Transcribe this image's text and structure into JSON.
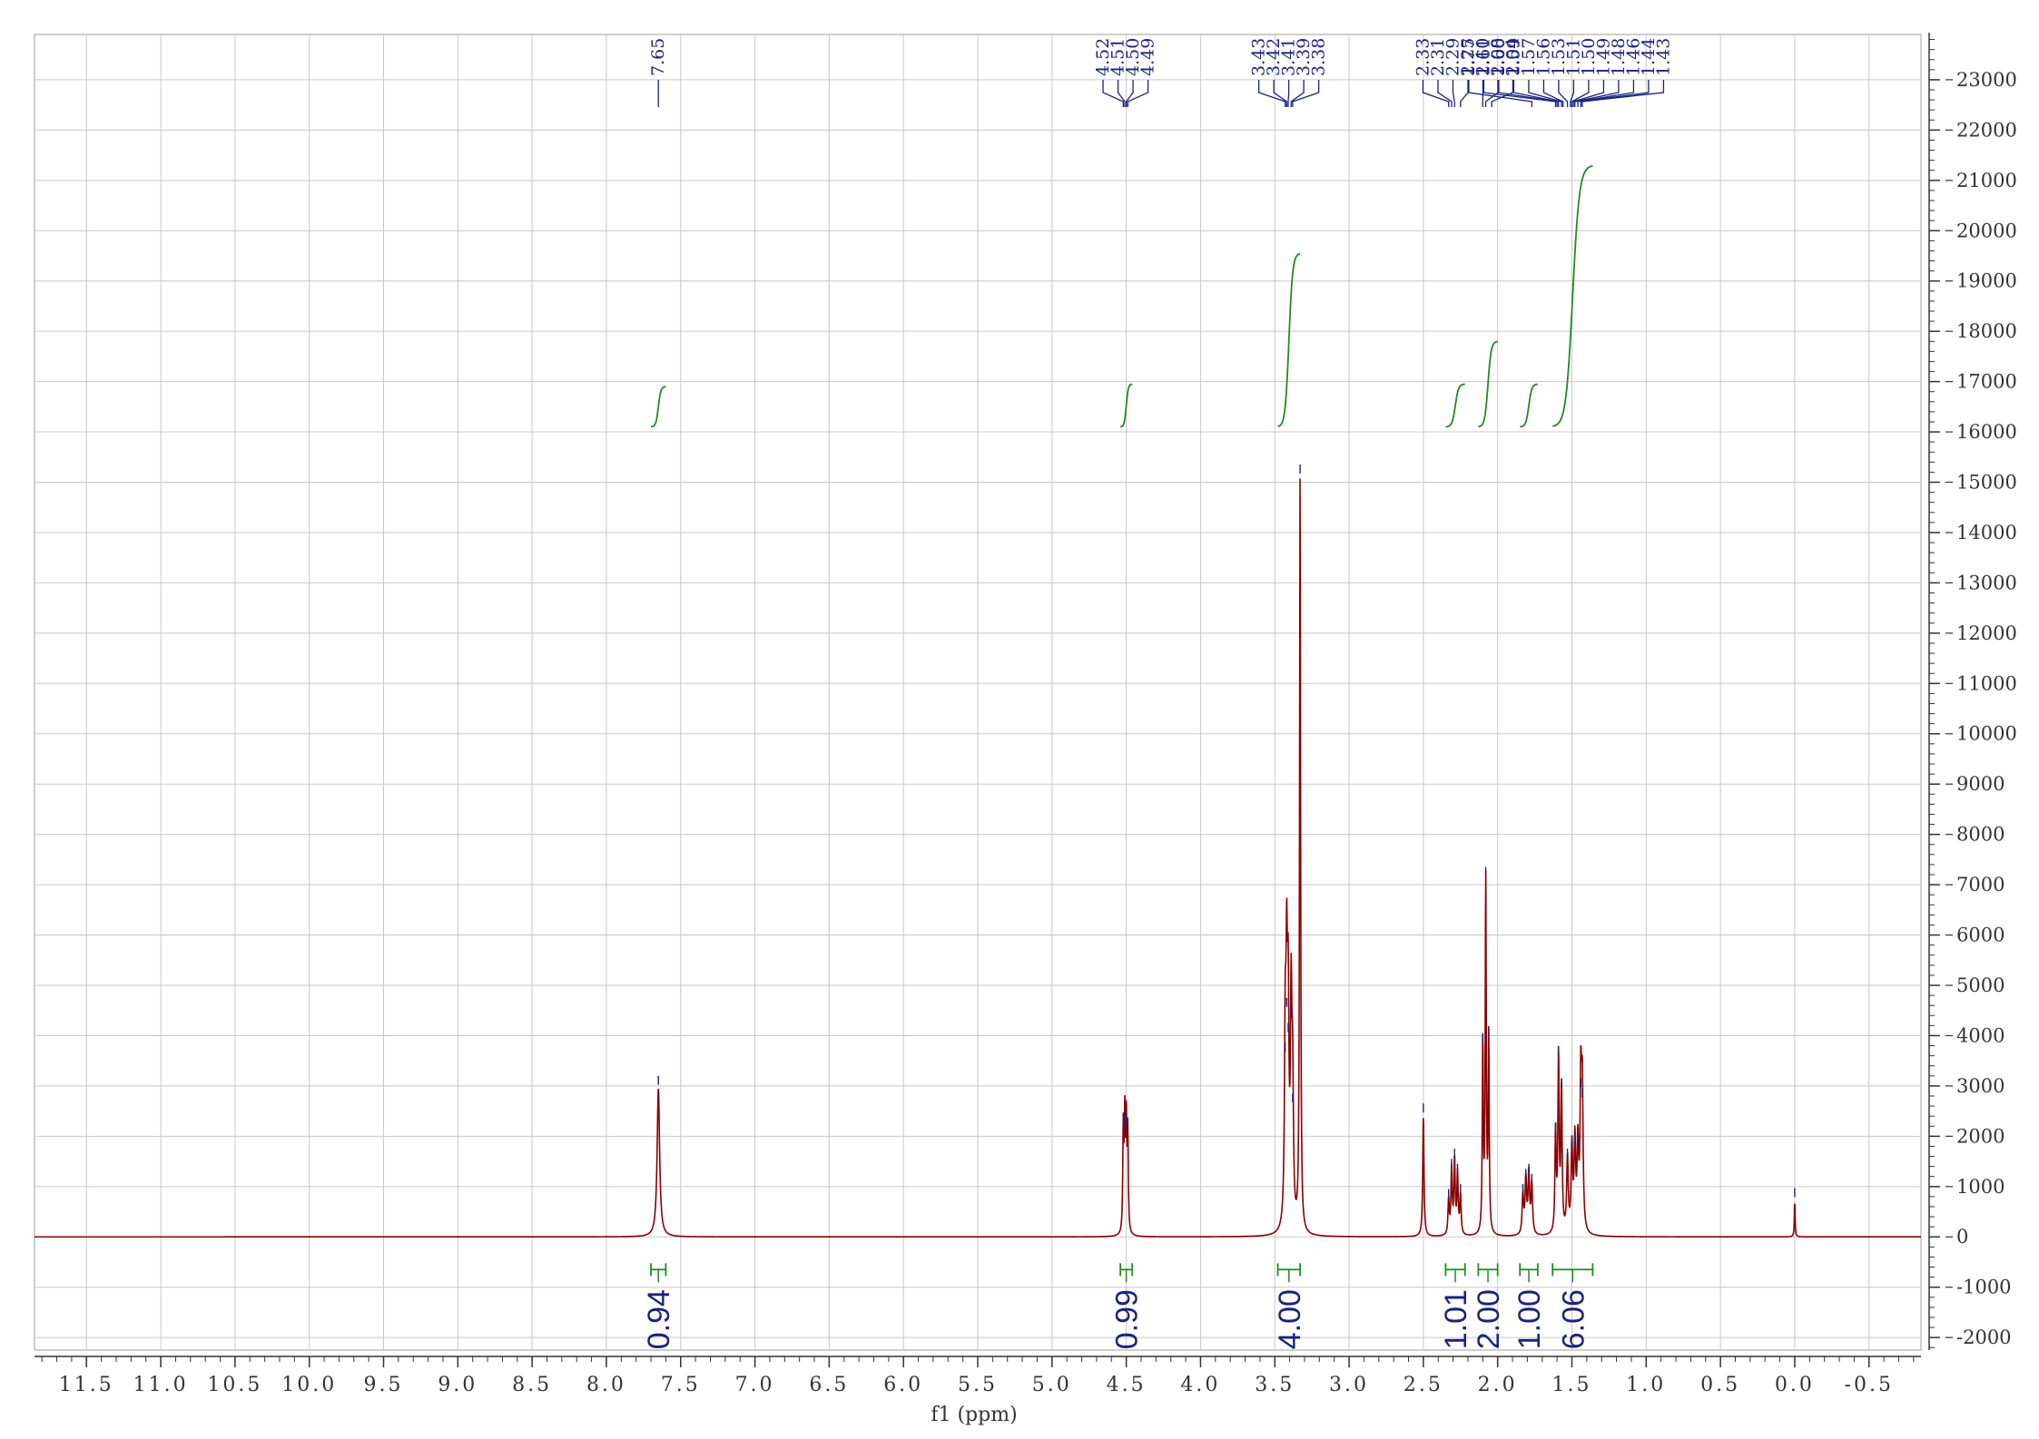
{
  "chart_data": {
    "type": "line",
    "xlabel": "f1 (ppm)",
    "xlim": [
      11.85,
      -0.85
    ],
    "ylim": [
      -2250,
      23900
    ],
    "x_ticks": [
      "11.5",
      "11.0",
      "10.5",
      "10.0",
      "9.5",
      "9.0",
      "8.5",
      "8.0",
      "7.5",
      "7.0",
      "6.5",
      "6.0",
      "5.5",
      "5.0",
      "4.5",
      "4.0",
      "3.5",
      "3.0",
      "2.5",
      "2.0",
      "1.5",
      "1.0",
      "0.5",
      "0.0",
      "-0.5"
    ],
    "y_ticks": [
      "23000",
      "22000",
      "21000",
      "20000",
      "19000",
      "18000",
      "17000",
      "16000",
      "15000",
      "14000",
      "13000",
      "12000",
      "11000",
      "10000",
      "9000",
      "8000",
      "7000",
      "6000",
      "5000",
      "4000",
      "3000",
      "2000",
      "1000",
      "0",
      "-1000",
      "-2000"
    ],
    "grid": true,
    "colors": {
      "spectrum": "#8b0000",
      "integral": "#228b22",
      "peak_label": "#1a237e",
      "grid": "#c8c8c8"
    },
    "spectrum_peaks": [
      {
        "ppm": 7.65,
        "height": 2950,
        "width": 0.01
      },
      {
        "ppm": 4.52,
        "height": 2050,
        "width": 0.004
      },
      {
        "ppm": 4.51,
        "height": 2200,
        "width": 0.004
      },
      {
        "ppm": 4.5,
        "height": 2150,
        "width": 0.004
      },
      {
        "ppm": 4.49,
        "height": 1950,
        "width": 0.004
      },
      {
        "ppm": 3.43,
        "height": 3600,
        "width": 0.006
      },
      {
        "ppm": 3.42,
        "height": 4500,
        "width": 0.006
      },
      {
        "ppm": 3.41,
        "height": 4000,
        "width": 0.006
      },
      {
        "ppm": 3.39,
        "height": 4300,
        "width": 0.006
      },
      {
        "ppm": 3.38,
        "height": 2600,
        "width": 0.006
      },
      {
        "ppm": 3.33,
        "height": 15100,
        "width": 0.004
      },
      {
        "ppm": 2.5,
        "height": 2400,
        "width": 0.005
      },
      {
        "ppm": 2.33,
        "height": 700,
        "width": 0.005
      },
      {
        "ppm": 2.31,
        "height": 1300,
        "width": 0.005
      },
      {
        "ppm": 2.29,
        "height": 1500,
        "width": 0.005
      },
      {
        "ppm": 2.27,
        "height": 1200,
        "width": 0.005
      },
      {
        "ppm": 2.25,
        "height": 800,
        "width": 0.005
      },
      {
        "ppm": 2.1,
        "height": 3800,
        "width": 0.004
      },
      {
        "ppm": 2.08,
        "height": 7100,
        "width": 0.004
      },
      {
        "ppm": 2.06,
        "height": 3900,
        "width": 0.004
      },
      {
        "ppm": 1.83,
        "height": 800,
        "width": 0.006
      },
      {
        "ppm": 1.81,
        "height": 1100,
        "width": 0.006
      },
      {
        "ppm": 1.79,
        "height": 1200,
        "width": 0.006
      },
      {
        "ppm": 1.77,
        "height": 1000,
        "width": 0.006
      },
      {
        "ppm": 1.61,
        "height": 2000,
        "width": 0.005
      },
      {
        "ppm": 1.59,
        "height": 3500,
        "width": 0.005
      },
      {
        "ppm": 1.57,
        "height": 2900,
        "width": 0.005
      },
      {
        "ppm": 1.53,
        "height": 1500,
        "width": 0.006
      },
      {
        "ppm": 1.5,
        "height": 1700,
        "width": 0.006
      },
      {
        "ppm": 1.48,
        "height": 1800,
        "width": 0.006
      },
      {
        "ppm": 1.46,
        "height": 1700,
        "width": 0.006
      },
      {
        "ppm": 1.44,
        "height": 2900,
        "width": 0.006
      },
      {
        "ppm": 1.43,
        "height": 2700,
        "width": 0.006
      },
      {
        "ppm": 0.0,
        "height": 720,
        "width": 0.003
      }
    ],
    "peak_labels": [
      {
        "group": [
          7.65
        ],
        "labels": [
          "7.65"
        ]
      },
      {
        "group": [
          4.52,
          4.51,
          4.5,
          4.49
        ],
        "labels": [
          "4.52",
          "4.51",
          "4.50",
          "4.49"
        ]
      },
      {
        "group": [
          3.43,
          3.42,
          3.41,
          3.39,
          3.38
        ],
        "labels": [
          "3.43",
          "3.42",
          "3.41",
          "3.39",
          "3.38"
        ]
      },
      {
        "group": [
          2.33,
          2.31,
          2.29,
          2.25,
          2.1,
          2.08,
          2.04
        ],
        "labels": [
          "2.33",
          "2.31",
          "2.29",
          "2.25",
          "2.10",
          "2.08",
          "2.04"
        ]
      },
      {
        "group": [
          1.77,
          1.61,
          1.6,
          1.59,
          1.57,
          1.56,
          1.53,
          1.51,
          1.5,
          1.49,
          1.48,
          1.46,
          1.44,
          1.43
        ],
        "labels": [
          "1.77",
          "1.61",
          "1.60",
          "1.59",
          "1.57",
          "1.56",
          "1.53",
          "1.51",
          "1.50",
          "1.49",
          "1.48",
          "1.46",
          "1.44",
          "1.43"
        ]
      }
    ],
    "integrals": [
      {
        "from": 7.7,
        "to": 7.6,
        "value": "0.94",
        "curve_start": 16100,
        "curve_end": 16900
      },
      {
        "from": 4.54,
        "to": 4.46,
        "value": "0.99",
        "curve_start": 16100,
        "curve_end": 16950
      },
      {
        "from": 3.48,
        "to": 3.33,
        "value": "4.00",
        "curve_start": 16100,
        "curve_end": 19550
      },
      {
        "from": 2.35,
        "to": 2.22,
        "value": "1.01",
        "curve_start": 16100,
        "curve_end": 16950
      },
      {
        "from": 2.13,
        "to": 2.0,
        "value": "2.00",
        "curve_start": 16100,
        "curve_end": 17800
      },
      {
        "from": 1.85,
        "to": 1.73,
        "value": "1.00",
        "curve_start": 16100,
        "curve_end": 16950
      },
      {
        "from": 1.63,
        "to": 1.36,
        "value": "6.06",
        "curve_start": 16100,
        "curve_end": 21300
      }
    ]
  }
}
